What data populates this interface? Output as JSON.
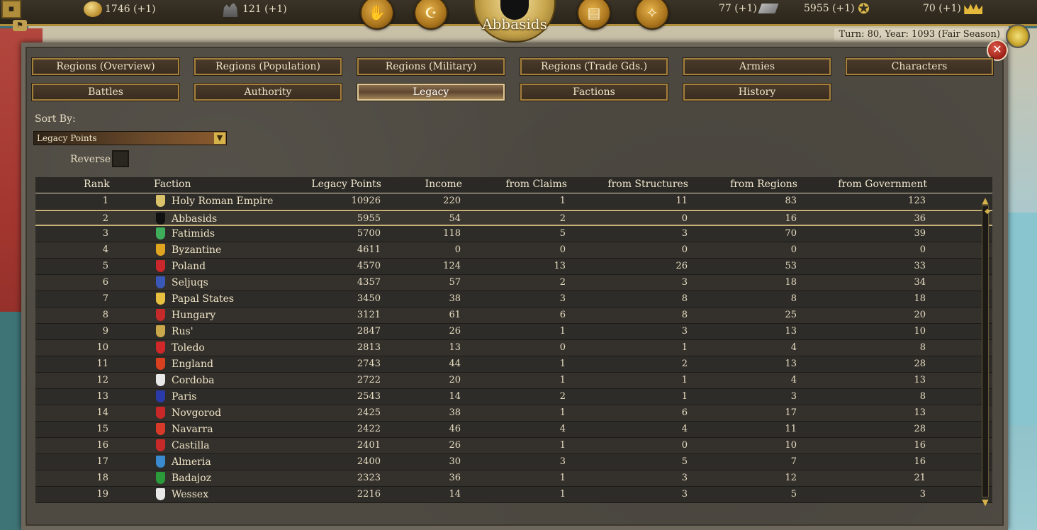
{
  "topbar": {
    "menu_icon": "menu-square",
    "gold": "1746 (+1)",
    "population": "121 (+1)",
    "resource_a": "77 (+1)",
    "legacy": "5955 (+1)",
    "authority": "70 (+1)",
    "faction_name": "Abbasids",
    "turn": "Turn: 80, Year: 1093 (Fair Season)"
  },
  "tabs_row1": [
    "Regions (Overview)",
    "Regions (Population)",
    "Regions (Military)",
    "Regions (Trade Gds.)",
    "Armies",
    "Characters"
  ],
  "tabs_row2": [
    "Battles",
    "Authority",
    "Legacy",
    "Factions",
    "History"
  ],
  "active_tab": "Legacy",
  "sort": {
    "label": "Sort By:",
    "selected": "Legacy Points",
    "reverse_label": "Reverse"
  },
  "table": {
    "headers": {
      "rank": "Rank",
      "faction": "Faction",
      "legacy": "Legacy Points",
      "income": "Income",
      "claims": "from Claims",
      "structures": "from Structures",
      "regions": "from Regions",
      "government": "from Government"
    },
    "rows": [
      {
        "rank": "1",
        "faction": "Holy Roman Empire",
        "legacy": "10926",
        "income": "220",
        "claims": "1",
        "structures": "11",
        "regions": "83",
        "government": "123",
        "color": "#d9c26a"
      },
      {
        "rank": "2",
        "faction": "Abbasids",
        "legacy": "5955",
        "income": "54",
        "claims": "2",
        "structures": "0",
        "regions": "16",
        "government": "36",
        "color": "#111111"
      },
      {
        "rank": "3",
        "faction": "Fatimids",
        "legacy": "5700",
        "income": "118",
        "claims": "5",
        "structures": "3",
        "regions": "70",
        "government": "39",
        "color": "#3fae5a"
      },
      {
        "rank": "4",
        "faction": "Byzantine",
        "legacy": "4611",
        "income": "0",
        "claims": "0",
        "structures": "0",
        "regions": "0",
        "government": "0",
        "color": "#e0a520"
      },
      {
        "rank": "5",
        "faction": "Poland",
        "legacy": "4570",
        "income": "124",
        "claims": "13",
        "structures": "26",
        "regions": "53",
        "government": "33",
        "color": "#c8282c"
      },
      {
        "rank": "6",
        "faction": "Seljuqs",
        "legacy": "4357",
        "income": "57",
        "claims": "2",
        "structures": "3",
        "regions": "18",
        "government": "34",
        "color": "#3a58b8"
      },
      {
        "rank": "7",
        "faction": "Papal States",
        "legacy": "3450",
        "income": "38",
        "claims": "3",
        "structures": "8",
        "regions": "8",
        "government": "18",
        "color": "#e8c040"
      },
      {
        "rank": "8",
        "faction": "Hungary",
        "legacy": "3121",
        "income": "61",
        "claims": "6",
        "structures": "8",
        "regions": "25",
        "government": "20",
        "color": "#c42a2a"
      },
      {
        "rank": "9",
        "faction": "Rus'",
        "legacy": "2847",
        "income": "26",
        "claims": "1",
        "structures": "3",
        "regions": "13",
        "government": "10",
        "color": "#c8a84a"
      },
      {
        "rank": "10",
        "faction": "Toledo",
        "legacy": "2813",
        "income": "13",
        "claims": "0",
        "structures": "1",
        "regions": "4",
        "government": "8",
        "color": "#d02828"
      },
      {
        "rank": "11",
        "faction": "England",
        "legacy": "2743",
        "income": "44",
        "claims": "1",
        "structures": "2",
        "regions": "13",
        "government": "28",
        "color": "#d84020"
      },
      {
        "rank": "12",
        "faction": "Cordoba",
        "legacy": "2722",
        "income": "20",
        "claims": "1",
        "structures": "1",
        "regions": "4",
        "government": "13",
        "color": "#e8e8e8"
      },
      {
        "rank": "13",
        "faction": "Paris",
        "legacy": "2543",
        "income": "14",
        "claims": "2",
        "structures": "1",
        "regions": "3",
        "government": "8",
        "color": "#2a3aa8"
      },
      {
        "rank": "14",
        "faction": "Novgorod",
        "legacy": "2425",
        "income": "38",
        "claims": "1",
        "structures": "6",
        "regions": "17",
        "government": "13",
        "color": "#c82828"
      },
      {
        "rank": "15",
        "faction": "Navarra",
        "legacy": "2422",
        "income": "46",
        "claims": "4",
        "structures": "4",
        "regions": "11",
        "government": "28",
        "color": "#d83a2a"
      },
      {
        "rank": "16",
        "faction": "Castilla",
        "legacy": "2401",
        "income": "26",
        "claims": "1",
        "structures": "0",
        "regions": "10",
        "government": "16",
        "color": "#c82a2a"
      },
      {
        "rank": "17",
        "faction": "Almeria",
        "legacy": "2400",
        "income": "30",
        "claims": "3",
        "structures": "5",
        "regions": "7",
        "government": "16",
        "color": "#3a8ad0"
      },
      {
        "rank": "18",
        "faction": "Badajoz",
        "legacy": "2323",
        "income": "36",
        "claims": "1",
        "structures": "3",
        "regions": "12",
        "government": "21",
        "color": "#2a9a3a"
      },
      {
        "rank": "19",
        "faction": "Wessex",
        "legacy": "2216",
        "income": "14",
        "claims": "1",
        "structures": "3",
        "regions": "5",
        "government": "3",
        "color": "#e8e8e8"
      }
    ]
  }
}
